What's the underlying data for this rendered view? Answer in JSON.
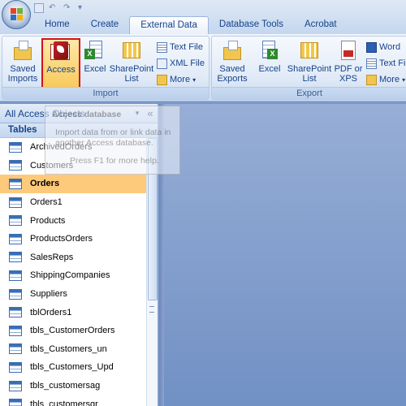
{
  "tabs": [
    {
      "label": "Home"
    },
    {
      "label": "Create"
    },
    {
      "label": "External Data",
      "active": true
    },
    {
      "label": "Database Tools"
    },
    {
      "label": "Acrobat"
    }
  ],
  "ribbon": {
    "import_group": {
      "label": "Import",
      "saved_imports": "Saved Imports",
      "access": "Access",
      "excel": "Excel",
      "sharepoint_list": "SharePoint List",
      "text_file": "Text File",
      "xml_file": "XML File",
      "more": "More"
    },
    "export_group": {
      "label": "Export",
      "saved_exports": "Saved Exports",
      "excel": "Excel",
      "sharepoint_list": "SharePoint List",
      "pdf_or_xps": "PDF or XPS",
      "word": "Word",
      "text_file": "Text Fil",
      "more": "More"
    }
  },
  "nav": {
    "header": "All Access Objects",
    "group": "Tables",
    "items": [
      {
        "label": "ArchivedOrders"
      },
      {
        "label": "Customers"
      },
      {
        "label": "Orders",
        "selected": true
      },
      {
        "label": "Orders1"
      },
      {
        "label": "Products"
      },
      {
        "label": "ProductsOrders"
      },
      {
        "label": "SalesReps"
      },
      {
        "label": "ShippingCompanies"
      },
      {
        "label": "Suppliers"
      },
      {
        "label": "tblOrders1"
      },
      {
        "label": "tbls_CustomerOrders"
      },
      {
        "label": "tbls_Customers_un"
      },
      {
        "label": "tbls_Customers_Upd"
      },
      {
        "label": "tbls_customersag"
      },
      {
        "label": "tbls_customersgr"
      }
    ]
  },
  "tooltip": {
    "title": "Access database",
    "body": "Import data from or link data in another Access database.",
    "help": "Press F1 for more help."
  },
  "colors": {
    "accent": "#15428b",
    "highlight_border": "#d6101a",
    "selected_row": "#fcca7a",
    "workspace": "#7a98c7"
  }
}
